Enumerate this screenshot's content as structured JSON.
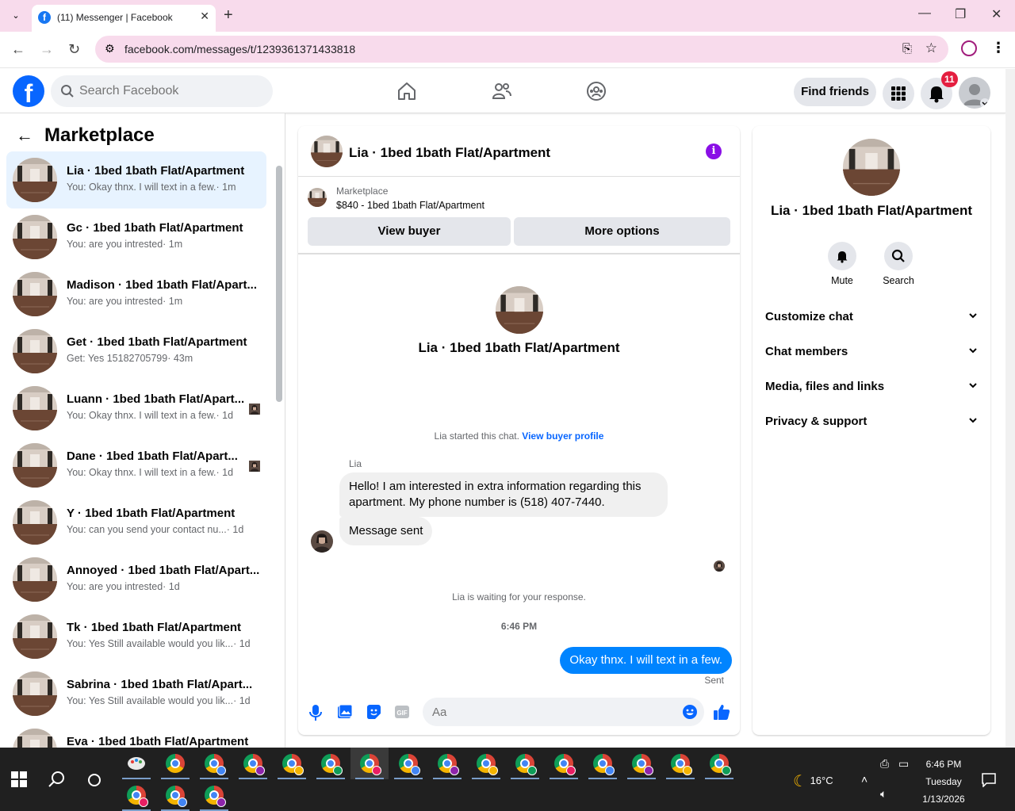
{
  "browser": {
    "tab_title": "(11) Messenger | Facebook",
    "url": "facebook.com/messages/t/1239361371433818"
  },
  "fb": {
    "search_placeholder": "Search Facebook",
    "find_friends": "Find friends",
    "notification_count": "11"
  },
  "sidebar": {
    "title": "Marketplace",
    "conversations": [
      {
        "name": "Lia · 1bed 1bath Flat/Apartment",
        "snippet": "You: Okay thnx. I will text in a few.",
        "time": "· 1m",
        "active": true
      },
      {
        "name": "Gc · 1bed 1bath Flat/Apartment",
        "snippet": "You: are you intrested",
        "time": "· 1m"
      },
      {
        "name": "Madison · 1bed 1bath Flat/Apart...",
        "snippet": "You: are you intrested",
        "time": "· 1m"
      },
      {
        "name": "Get · 1bed 1bath Flat/Apartment",
        "snippet": "Get: Yes 15182705799",
        "time": "· 43m"
      },
      {
        "name": "Luann · 1bed 1bath Flat/Apart...",
        "snippet": "You: Okay thnx. I will text in a few.",
        "time": "· 1d",
        "seen": true
      },
      {
        "name": "Dane · 1bed 1bath Flat/Apart...",
        "snippet": "You: Okay thnx. I will text in a few.",
        "time": "· 1d",
        "seen": true
      },
      {
        "name": "Y · 1bed 1bath Flat/Apartment",
        "snippet": "You: can you send your contact nu...",
        "time": "· 1d"
      },
      {
        "name": "Annoyed · 1bed 1bath Flat/Apart...",
        "snippet": "You: are you intrested",
        "time": "· 1d"
      },
      {
        "name": "Tk · 1bed 1bath Flat/Apartment",
        "snippet": "You: Yes Still available would you lik...",
        "time": "· 1d"
      },
      {
        "name": "Sabrina · 1bed 1bath Flat/Apart...",
        "snippet": "You: Yes Still available would you lik...",
        "time": "· 1d"
      },
      {
        "name": "Eva · 1bed 1bath Flat/Apartment",
        "snippet": "",
        "time": ""
      }
    ]
  },
  "chat": {
    "title": "Lia · 1bed 1bath Flat/Apartment",
    "marketplace_label": "Marketplace",
    "listing": "$840 - 1bed 1bath Flat/Apartment",
    "view_buyer": "View buyer",
    "more_options": "More options",
    "hero_name": "Lia · 1bed 1bath Flat/Apartment",
    "started_text": "Lia started this chat.",
    "view_buyer_profile": "View buyer profile",
    "sender_name": "Lia",
    "msg1": "Hello! I am interested in extra information regarding this apartment. My phone number is (518) 407-7440.",
    "msg2": "Message sent",
    "waiting": "Lia is waiting for your response.",
    "timestamp": "6:46 PM",
    "my_msg": "Okay thnx. I will text in a few.",
    "sent_label": "Sent",
    "composer_placeholder": "Aa"
  },
  "details": {
    "name": "Lia · 1bed 1bath Flat/Apartment",
    "mute": "Mute",
    "search": "Search",
    "rows": [
      "Customize chat",
      "Chat members",
      "Media, files and links",
      "Privacy & support"
    ]
  },
  "taskbar": {
    "temperature": "16°C",
    "time": "6:46 PM",
    "day": "Tuesday",
    "date": "1/13/2026"
  }
}
